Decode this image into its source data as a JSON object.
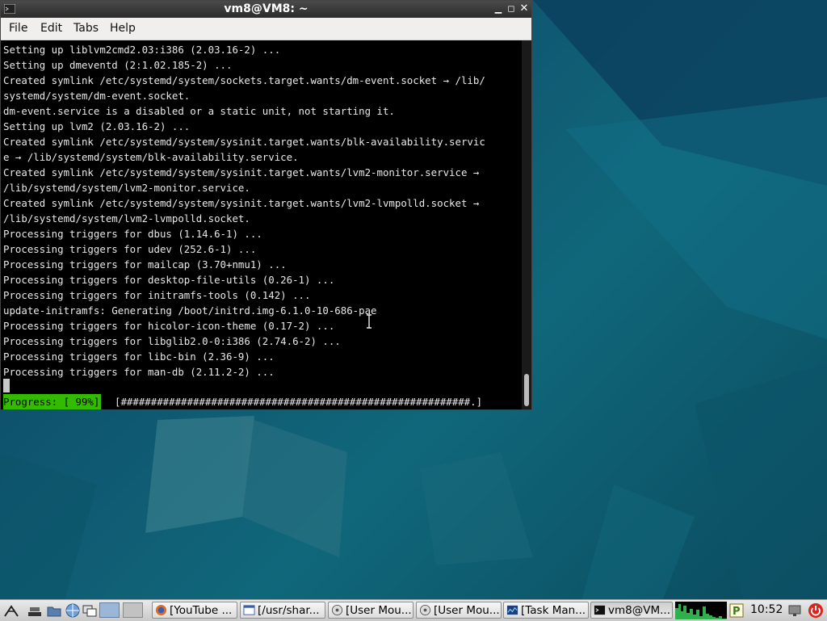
{
  "window": {
    "title": "vm8@VM8: ~",
    "controls": [
      "minimize-icon",
      "maximize-icon",
      "close-icon"
    ]
  },
  "menu": [
    "File",
    "Edit",
    "Tabs",
    "Help"
  ],
  "terminal": {
    "lines": [
      "Setting up liblvm2cmd2.03:i386 (2.03.16-2) ...",
      "Setting up dmeventd (2:1.02.185-2) ...",
      "Created symlink /etc/systemd/system/sockets.target.wants/dm-event.socket → /lib/",
      "systemd/system/dm-event.socket.",
      "dm-event.service is a disabled or a static unit, not starting it.",
      "Setting up lvm2 (2.03.16-2) ...",
      "Created symlink /etc/systemd/system/sysinit.target.wants/blk-availability.servic",
      "e → /lib/systemd/system/blk-availability.service.",
      "Created symlink /etc/systemd/system/sysinit.target.wants/lvm2-monitor.service →",
      "/lib/systemd/system/lvm2-monitor.service.",
      "Created symlink /etc/systemd/system/sysinit.target.wants/lvm2-lvmpolld.socket →",
      "/lib/systemd/system/lvm2-lvmpolld.socket.",
      "Processing triggers for dbus (1.14.6-1) ...",
      "Processing triggers for udev (252.6-1) ...",
      "Processing triggers for mailcap (3.70+nmu1) ...",
      "Processing triggers for desktop-file-utils (0.26-1) ...",
      "Processing triggers for initramfs-tools (0.142) ...",
      "update-initramfs: Generating /boot/initrd.img-6.1.0-10-686-pae",
      "Processing triggers for hicolor-icon-theme (0.17-2) ...",
      "Processing triggers for libglib2.0-0:i386 (2.74.6-2) ...",
      "Processing triggers for libc-bin (2.36-9) ...",
      "Processing triggers for man-db (2.11.2-2) ..."
    ],
    "progress_label": "Progress: [ 99%]",
    "progress_bar": "[##########################################################.]",
    "progress_value": 99
  },
  "taskbar": {
    "launchers": [
      "start-menu-icon",
      "show-desktop-icon",
      "file-manager-icon",
      "browser-icon",
      "window-switcher-icon",
      "workspace-1-icon",
      "workspace-2-icon"
    ],
    "tasks": [
      {
        "label": "[YouTube ...",
        "icon": "firefox-icon"
      },
      {
        "label": "[/usr/shar...",
        "icon": "text-editor-icon"
      },
      {
        "label": "[User Mou...",
        "icon": "user-mount-icon"
      },
      {
        "label": "[User Mou...",
        "icon": "user-mount-icon"
      },
      {
        "label": "[Task Man...",
        "icon": "task-manager-icon"
      },
      {
        "label": "vm8@VM...",
        "icon": "terminal-icon"
      }
    ],
    "clock": "10:52",
    "tray_icons": [
      "cpu-monitor-icon",
      "network-icon",
      "power-icon"
    ]
  },
  "colors": {
    "progress_bg": "#33bb00",
    "terminal_bg": "#000000",
    "terminal_fg": "#e8e8e8",
    "desktop": "#0f5a72"
  }
}
